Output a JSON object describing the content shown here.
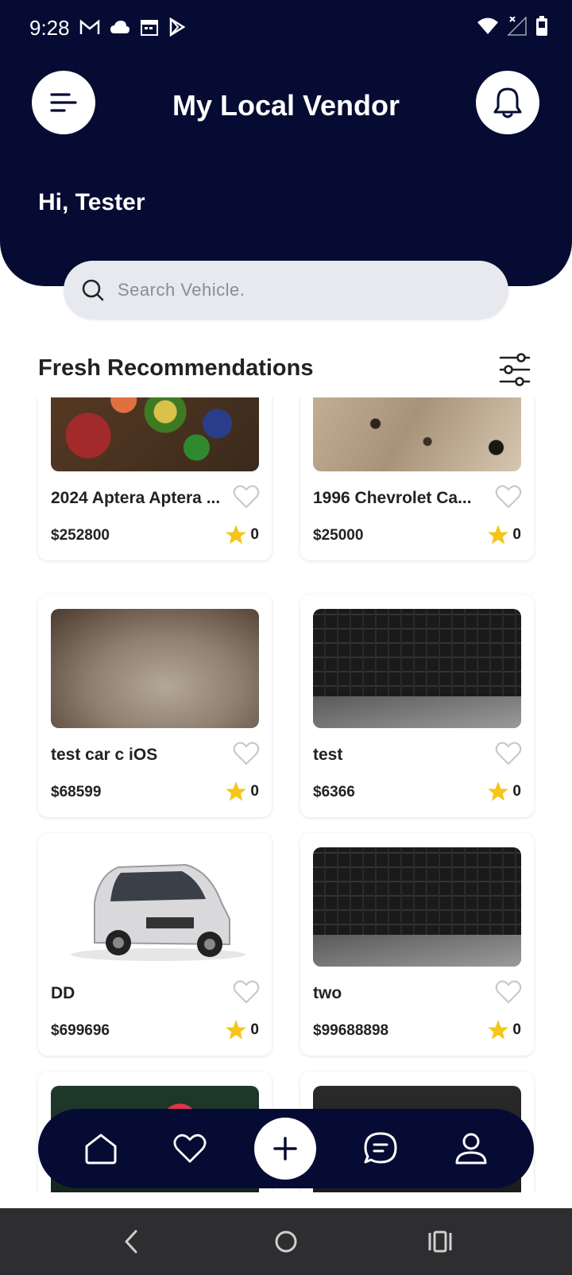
{
  "status_bar": {
    "time": "9:28",
    "left_icons": [
      "gmail-icon",
      "cloud-icon",
      "calendar-icon",
      "play-store-icon"
    ],
    "right_icons": [
      "wifi-icon",
      "signal-icon",
      "battery-icon"
    ]
  },
  "header": {
    "title": "My Local Vendor",
    "greeting": "Hi, Tester",
    "background_color": "#060b33"
  },
  "search": {
    "placeholder": "Search Vehicle."
  },
  "section": {
    "title": "Fresh Recommendations"
  },
  "listings": [
    {
      "name": "2024 Aptera Aptera ...",
      "price": "$252800",
      "rating": "0",
      "image": "groceries-photo"
    },
    {
      "name": "1996 Chevrolet Ca...",
      "price": "$25000",
      "rating": "0",
      "image": "granite-photo"
    },
    {
      "name": "test car c iOS",
      "price": "$68599",
      "rating": "0",
      "image": "blurry-photo"
    },
    {
      "name": "test",
      "price": "$6366",
      "rating": "0",
      "image": "keyboard-photo"
    },
    {
      "name": "DD",
      "price": "$699696",
      "rating": "0",
      "image": "car-photo"
    },
    {
      "name": "two",
      "price": "$99688898",
      "rating": "0",
      "image": "keyboard-photo"
    },
    {
      "name": "",
      "price": "",
      "rating": "",
      "image": "flower-photo"
    },
    {
      "name": "",
      "price": "",
      "rating": "",
      "image": "dark-photo"
    }
  ],
  "bottom_nav": {
    "items": [
      "home-icon",
      "favorites-icon",
      "add-icon",
      "chat-icon",
      "profile-icon"
    ]
  },
  "colors": {
    "accent": "#060b33",
    "star": "#f5c518"
  }
}
